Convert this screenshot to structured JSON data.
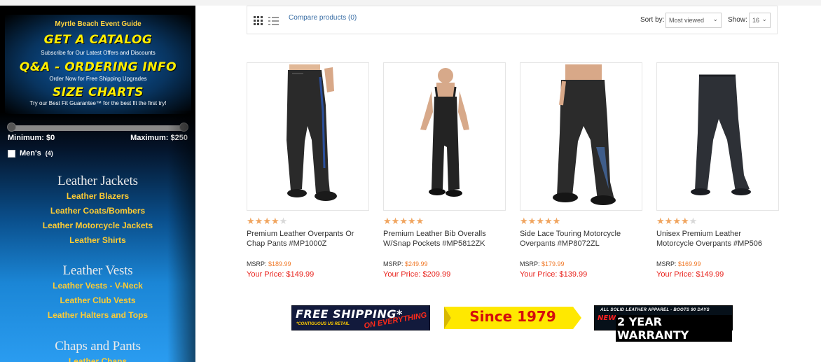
{
  "sidebar": {
    "banner": {
      "guide": "Myrtle Beach Event Guide",
      "catalog": "GET A CATALOG",
      "catalog_sub": "Subscribe for Our Latest Offers and Discounts",
      "qa": "Q&A - ORDERING INFO",
      "qa_sub": "Order Now for Free Shipping Upgrades",
      "size": "SIZE CHARTS",
      "size_sub": "Try our Best Fit Guarantee™ for the best fit the first try!"
    },
    "price_filter": {
      "min_label": "Minimum: $0",
      "max_label": "Maximum: $250"
    },
    "gender_filter": {
      "label": "Men's",
      "count": "(4)"
    },
    "categories": [
      {
        "heading": "Leather Jackets",
        "links": [
          "Leather Blazers",
          "Leather Coats/Bombers",
          "Leather Motorcycle Jackets",
          "Leather Shirts"
        ]
      },
      {
        "heading": "Leather Vests",
        "links": [
          "Leather Vests - V-Neck",
          "Leather Club Vests",
          "Leather Halters and Tops"
        ]
      },
      {
        "heading": "Chaps and Pants",
        "links": [
          "Leather Chaps"
        ]
      }
    ]
  },
  "toolbar": {
    "compare": "Compare products (0)",
    "sort_label": "Sort by:",
    "sort_value": "Most viewed",
    "show_label": "Show:",
    "show_value": "16"
  },
  "products": [
    {
      "name": "Premium Leather Overpants Or Chap Pants #MP1000Z",
      "rating": 4,
      "msrp_label": "MSRP:",
      "msrp": "$189.99",
      "price_label": "Your Price:",
      "price": "$149.99"
    },
    {
      "name": "Premium Leather Bib Overalls W/Snap Pockets #MP5812ZK",
      "rating": 5,
      "msrp_label": "MSRP:",
      "msrp": "$249.99",
      "price_label": "Your Price:",
      "price": "$209.99"
    },
    {
      "name": "Side Lace Touring Motorcycle Overpants #MP8072ZL",
      "rating": 5,
      "msrp_label": "MSRP:",
      "msrp": "$179.99",
      "price_label": "Your Price:",
      "price": "$139.99"
    },
    {
      "name": "Unisex Premium Leather Motorcycle Overpants #MP506",
      "rating": 4,
      "msrp_label": "MSRP:",
      "msrp": "$169.99",
      "price_label": "Your Price:",
      "price": "$149.99"
    }
  ],
  "badges": {
    "shipping": "FREE SHIPPING*",
    "shipping_sub": "*CONTIGUOUS US RETAIL",
    "shipping_tag": "ON EVERYTHING",
    "since": "Since 1979",
    "warranty_top": "ALL SOLID LEATHER APPAREL - BOOTS 90 DAYS",
    "warranty_new": "NEW",
    "warranty_main": "2 YEAR WARRANTY"
  },
  "colors": {
    "accent_link": "#ffcc33",
    "price_red": "#e8221c",
    "msrp_orange": "#f07a2a",
    "star": "#f0a560"
  }
}
